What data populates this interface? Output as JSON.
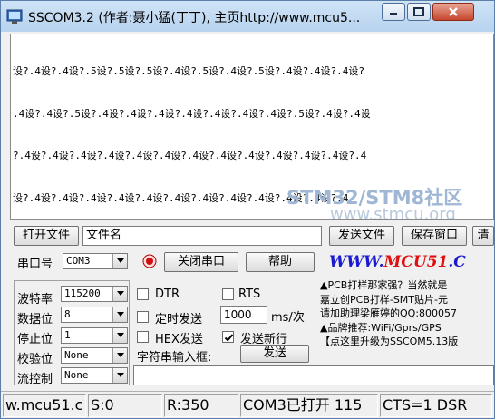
{
  "window": {
    "title": "SSCOM3.2 (作者:聂小猛(丁丁), 主页http://www.mcu5..."
  },
  "receive": {
    "lines": [
      "设?.4设?.4设?.5设?.5设?.5设?.4设?.5设?.4设?.5设?.4设?.4设?.4设?",
      ".4设?.4设?.5设?.4设?.4设?.4设?.4设?.4设?.4设?.4设?.5设?.4设?.4设",
      "?.4设?.4设?.4设?.4设?.4设?.4设?.4设?.4设?.4设?.4设?.4设?.4设?.4",
      "设?.4设?.4设?.4设?.4设?.4设?.4设?.4设?.4设?.4设?.4设?.4设?.4"
    ],
    "watermark_line1": "STM32/STM8社区",
    "watermark_line2": "www.stmcu.org"
  },
  "toolbar": {
    "open_file_label": "打开文件",
    "file_name_value": "文件名",
    "send_file_label": "发送文件",
    "save_window_label": "保存窗口",
    "clear_label": "清"
  },
  "port": {
    "label": "串口号",
    "value": "COM3",
    "close_port_label": "关闭串口",
    "help_label": "帮助"
  },
  "logo": {
    "text1": "WWW.",
    "text2": "MCU51",
    "text3": ".C"
  },
  "settings": {
    "baud_label": "波特率",
    "baud_value": "115200",
    "databits_label": "数据位",
    "databits_value": "8",
    "stopbits_label": "停止位",
    "stopbits_value": "1",
    "parity_label": "校验位",
    "parity_value": "None",
    "flow_label": "流控制",
    "flow_value": "None"
  },
  "options": {
    "dtr_label": "DTR",
    "rts_label": "RTS",
    "timed_send_label": "定时发送",
    "interval_value": "1000",
    "interval_unit": "ms/次",
    "hex_send_label": "HEX发送",
    "send_newline_label": "发送新行",
    "string_input_label": "字符串输入框:",
    "send_label": "发送"
  },
  "ad": {
    "line1": "▲PCB打样那家强？当然就是",
    "line2": "嘉立创PCB打样-SMT贴片-元",
    "line3": "请加助理梁雁婷的QQ:800057",
    "line4": "▲品牌推荐:WiFi/Gprs/GPS",
    "line5": "【点这里升级为SSCOM5.13版"
  },
  "status": {
    "site": "w.mcu51.c",
    "send_count": "S:0",
    "recv_count": "R:350",
    "port_state": "COM3已打开  115",
    "signals": "CTS=1 DSR"
  },
  "colors": {
    "logo_blue": "#1a1ad0",
    "logo_red": "#e01010",
    "record_red": "#d01010"
  }
}
